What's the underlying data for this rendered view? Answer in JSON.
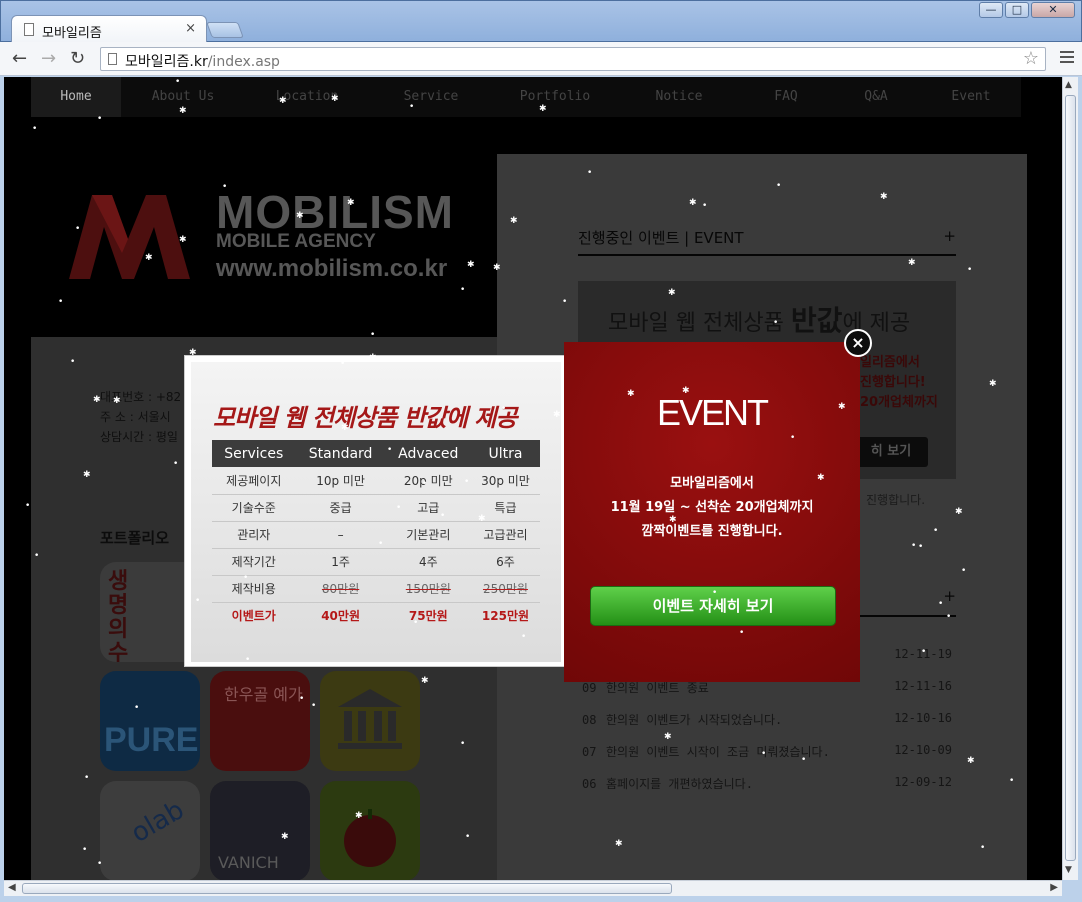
{
  "browser": {
    "tab_title": "모바일리즘",
    "tab_close": "×",
    "url_host": "모바일리즘.kr",
    "url_path": "/index.asp",
    "window_buttons": [
      "—",
      "□",
      "✕"
    ]
  },
  "site": {
    "nav": [
      "Home",
      "About Us",
      "Location",
      "Service",
      "Portfolio",
      "Notice",
      "FAQ",
      "Q&A",
      "Event"
    ],
    "logo": {
      "name": "MOBILISM",
      "tagline": "MOBILE AGENCY",
      "url": "www.mobilism.co.kr"
    },
    "contact": {
      "phone_label": "대표번호 : +82",
      "address_label": "주 소 : 서울시",
      "hours_label": "상담시간 : 평일"
    },
    "portfolio_title": "포트폴리오",
    "apps": [
      "생명의 수원",
      "PURE",
      "한우골 예가",
      "bank",
      "olab",
      "VANICH",
      "apple"
    ],
    "event_section": {
      "title": "진행중인 이벤트 | EVENT",
      "plus": "+",
      "banner_headline_prefix": "모바일 웹 전체상품 ",
      "banner_headline_bold": "반값",
      "banner_headline_suffix": "에 제공",
      "banner_line1": "일리즘에서",
      "banner_line2": "진행합니다!",
      "banner_line3": "20개업체까지",
      "banner_button": "히 보기",
      "banner_footer": "진행합니다."
    },
    "notice_section": {
      "plus": "+",
      "rows": [
        {
          "num": "",
          "title": "",
          "date": "12-11-19"
        },
        {
          "num": "09",
          "title": "한의원 이벤트 종료",
          "date": "12-11-16"
        },
        {
          "num": "08",
          "title": "한의원 이벤트가 시작되었습니다.",
          "date": "12-10-16"
        },
        {
          "num": "07",
          "title": "한의원 이벤트 시작이 조금 미뤄졌습니다.",
          "date": "12-10-09"
        },
        {
          "num": "06",
          "title": "홈페이지를 개편하였습니다.",
          "date": "12-09-12"
        }
      ]
    }
  },
  "popup": {
    "headline": "모바일 웹 전체상품 반값에 제공",
    "table": {
      "headers": [
        "Services",
        "Standard",
        "Advaced",
        "Ultra"
      ],
      "rows": [
        [
          "제공페이지",
          "10p 미만",
          "20p 미만",
          "30p 미만"
        ],
        [
          "기술수준",
          "중급",
          "고급",
          "특급"
        ],
        [
          "관리자",
          "–",
          "기본관리",
          "고급관리"
        ],
        [
          "제작기간",
          "1주",
          "4주",
          "6주"
        ],
        [
          "제작비용",
          "80만원",
          "150만원",
          "250만원"
        ],
        [
          "이벤트가",
          "40만원",
          "75만원",
          "125만원"
        ]
      ]
    },
    "event_title": "EVENT",
    "event_line1": "모바일리즘에서",
    "event_line2": "11월 19일 ~ 선착순 20개업체까지",
    "event_line3": "깜짝이벤트를 진행합니다.",
    "cta_label": "이벤트 자세히 보기",
    "close_label": "×"
  },
  "colors": {
    "popup_red": "#8b0b0b",
    "headline_red": "#a51818",
    "cta_green": "#3bb02a"
  }
}
